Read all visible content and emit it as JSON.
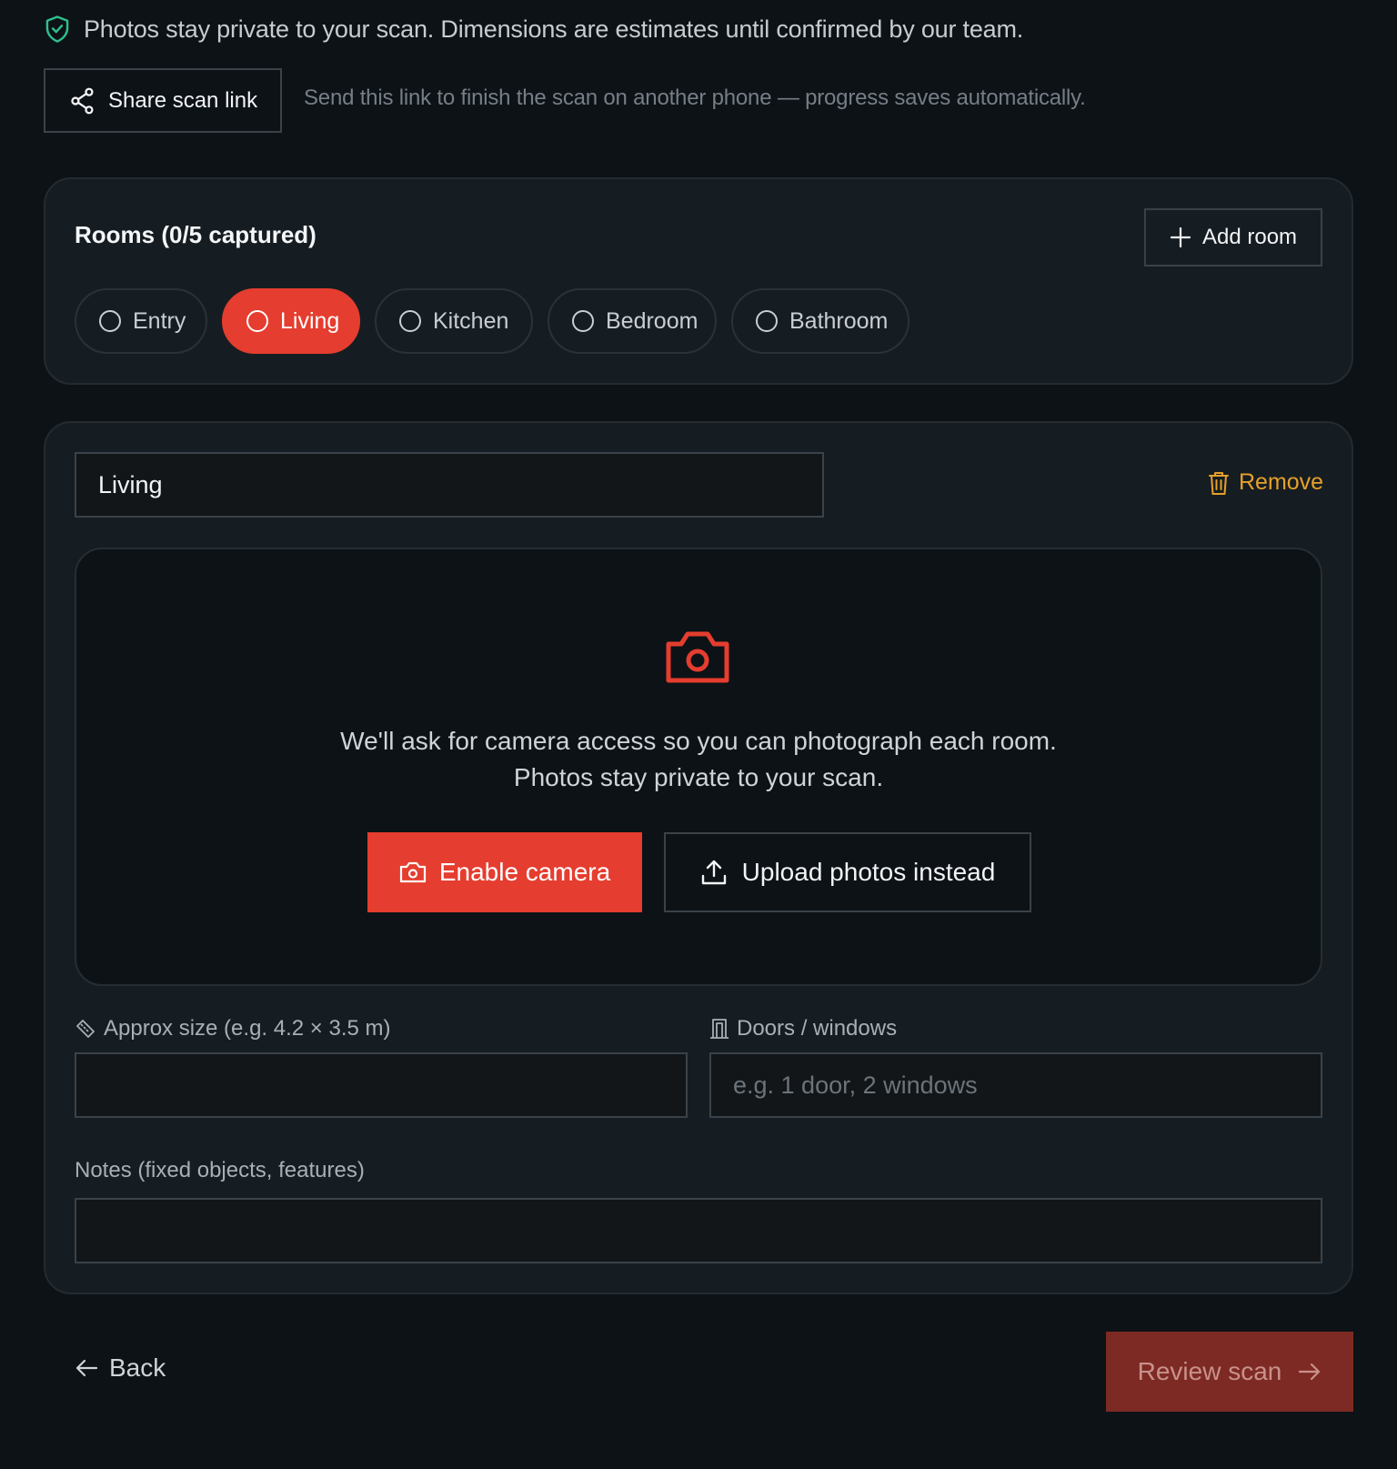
{
  "notice": {
    "text": "Photos stay private to your scan. Dimensions are estimates until confirmed by our team.",
    "icon": "shield-check-icon"
  },
  "share": {
    "button_label": "Share scan link",
    "hint": "Send this link to finish the scan on another phone — progress saves automatically.",
    "icon": "share-icon"
  },
  "rooms": {
    "title": "Rooms (0/5 captured)",
    "add_label": "Add room",
    "items": [
      {
        "label": "Entry",
        "active": false
      },
      {
        "label": "Living",
        "active": true
      },
      {
        "label": "Kitchen",
        "active": false
      },
      {
        "label": "Bedroom",
        "active": false
      },
      {
        "label": "Bathroom",
        "active": false
      }
    ]
  },
  "room_detail": {
    "name_value": "Living",
    "remove_label": "Remove",
    "camera_message": "We'll ask for camera access so you can photograph each room. Photos stay private to your scan.",
    "enable_camera_label": "Enable camera",
    "upload_label": "Upload photos instead",
    "size_label": "Approx size (e.g. 4.2 × 3.5 m)",
    "size_value": "",
    "doors_label": "Doors / windows",
    "doors_placeholder": "e.g. 1 door, 2 windows",
    "doors_value": "",
    "notes_label": "Notes (fixed objects, features)",
    "notes_value": ""
  },
  "footer": {
    "back_label": "Back",
    "review_label": "Review scan"
  },
  "colors": {
    "background": "#0d1217",
    "card": "#161d22",
    "accent": "#e53d2f",
    "accent_disabled": "#7e2a24",
    "warning": "#e6a02a",
    "success": "#2fbf8a"
  }
}
